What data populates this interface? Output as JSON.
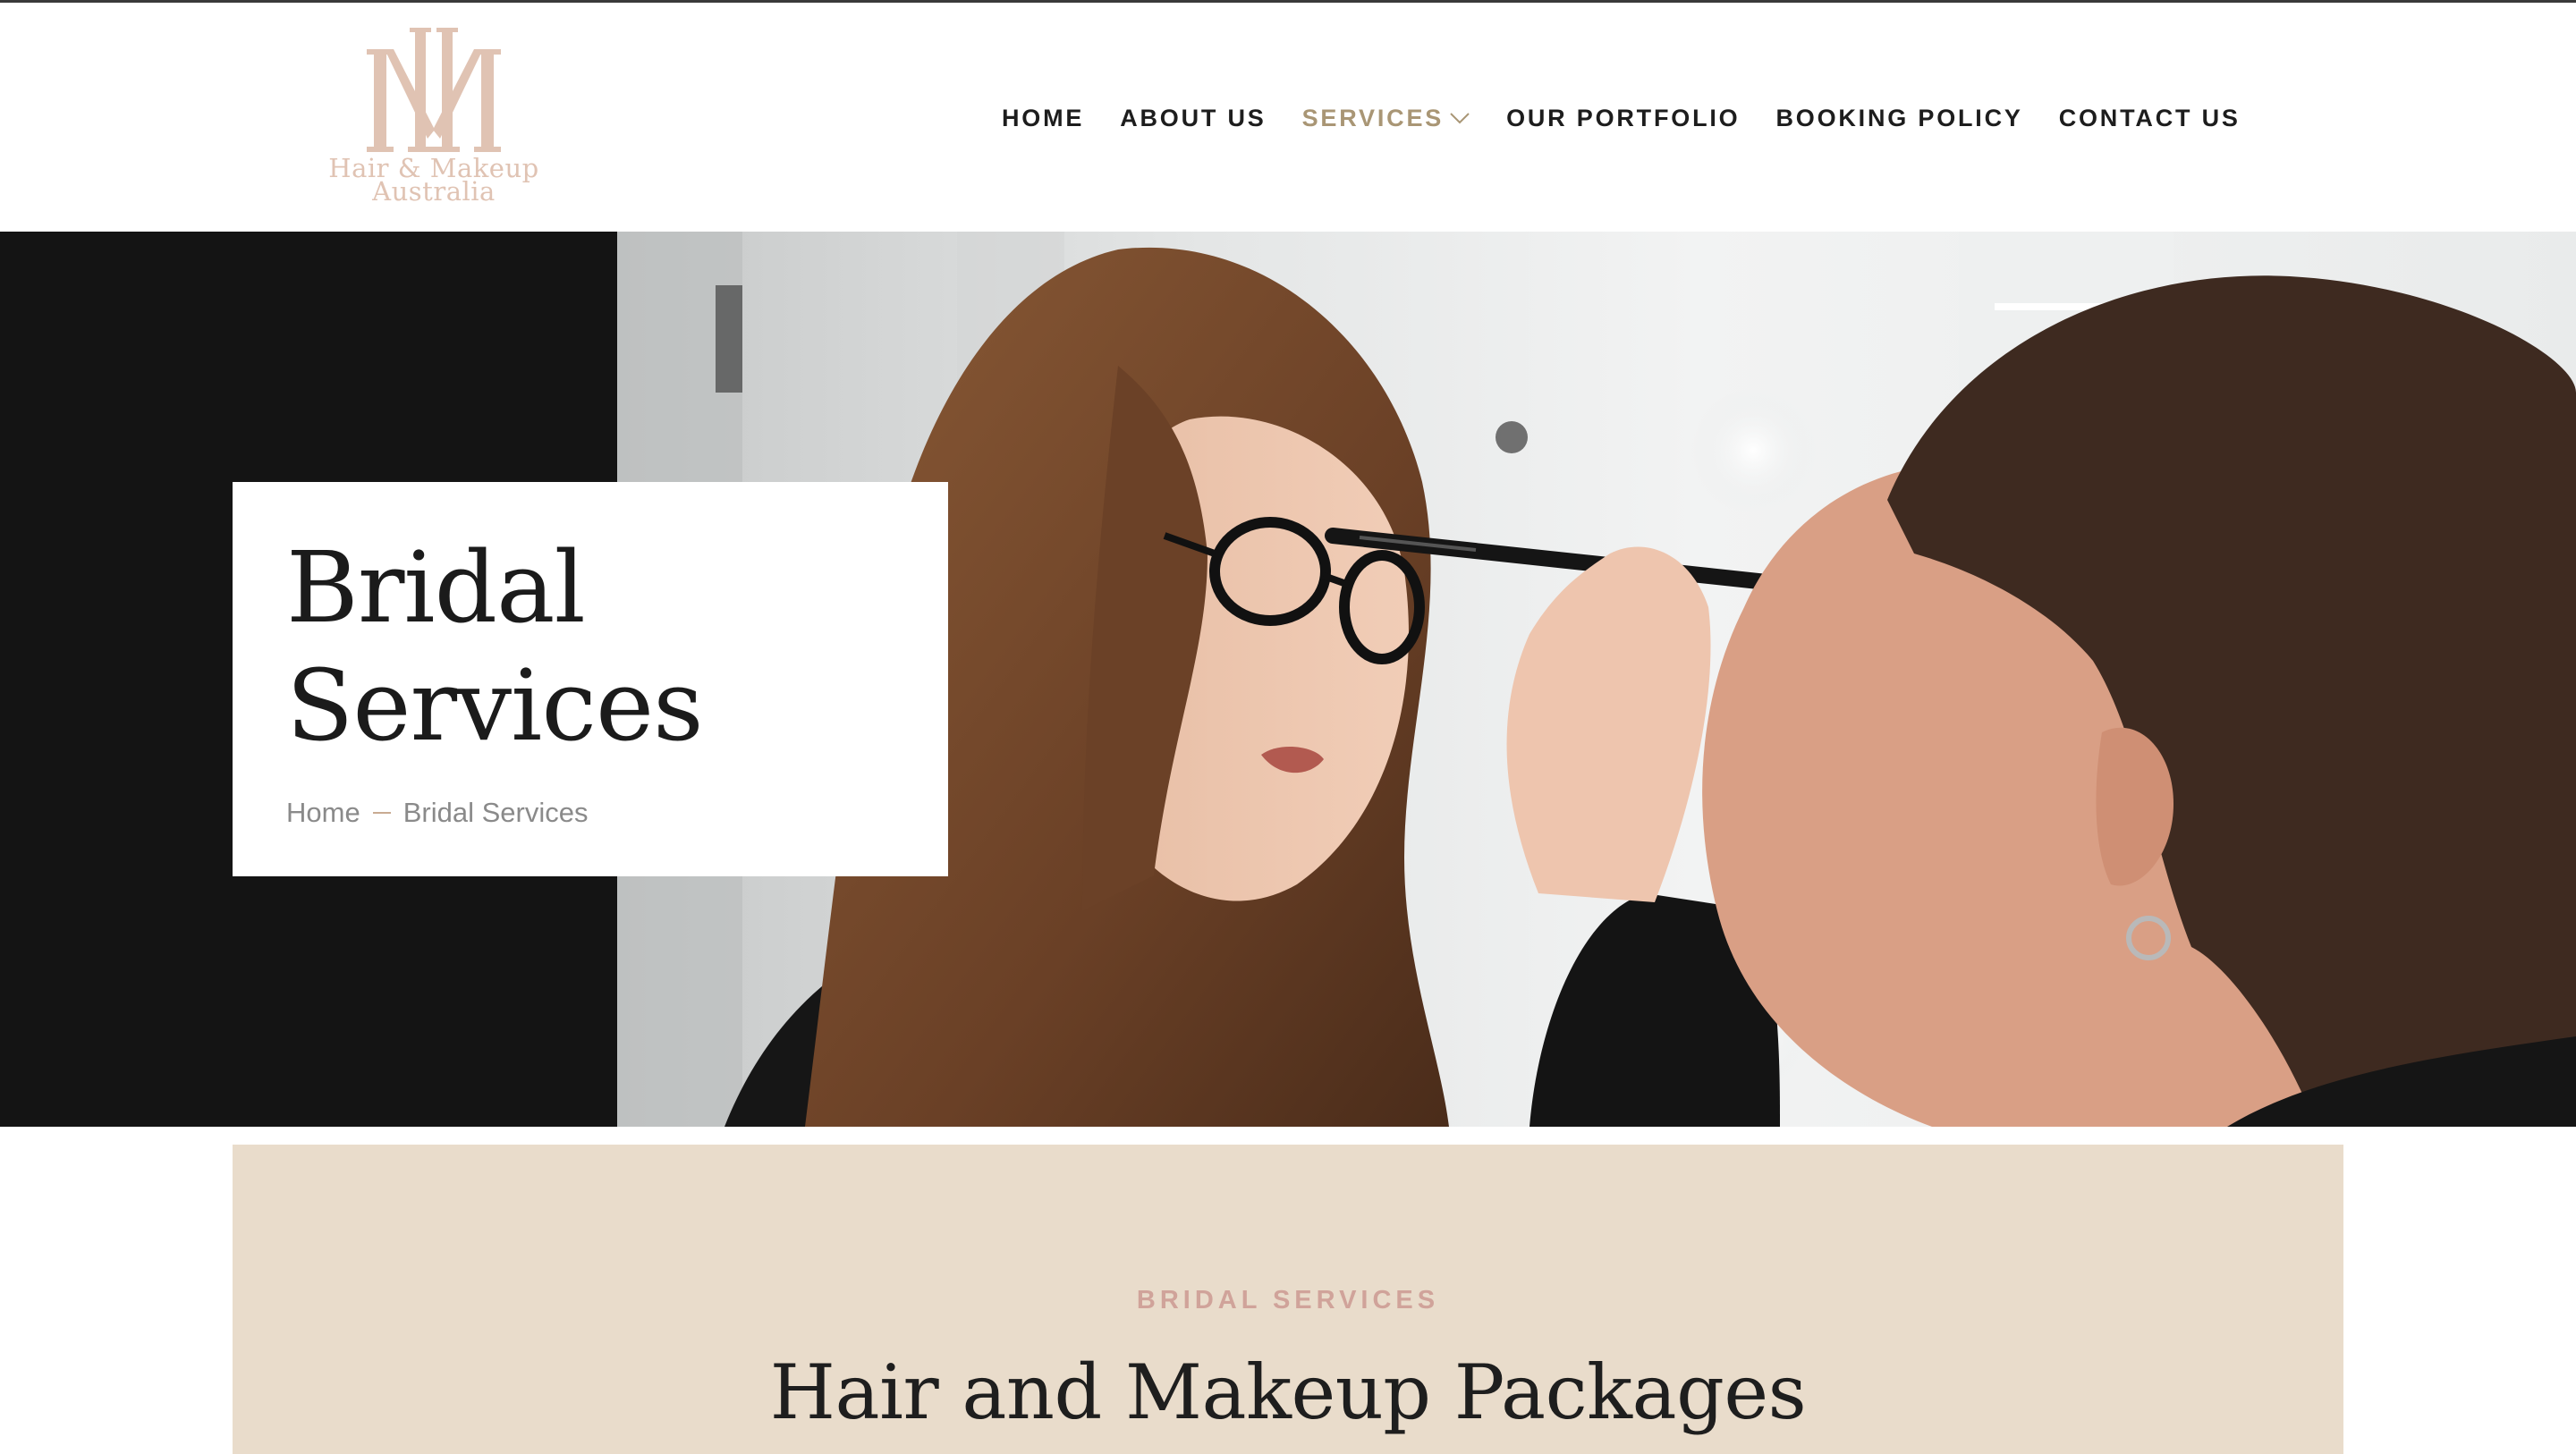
{
  "brand": {
    "monogram": "HM",
    "line1": "Hair & Makeup",
    "line2": "Australia",
    "color": "#e0c3b3"
  },
  "nav": {
    "items": [
      {
        "label": "HOME",
        "active": false
      },
      {
        "label": "ABOUT US",
        "active": false
      },
      {
        "label": "SERVICES",
        "active": true,
        "has_dropdown": true
      },
      {
        "label": "OUR PORTFOLIO",
        "active": false
      },
      {
        "label": "BOOKING POLICY",
        "active": false
      },
      {
        "label": "CONTACT US",
        "active": false
      }
    ],
    "active_color": "#a99675"
  },
  "hero": {
    "title_line1": "Bridal",
    "title_line2": "Services",
    "breadcrumb": {
      "home": "Home",
      "current": "Bridal Services"
    },
    "photo_subject": "makeup artist applying brow pencil to client"
  },
  "packages": {
    "eyebrow": "BRIDAL SERVICES",
    "title": "Hair and Makeup Packages",
    "background": "#e9dccb"
  }
}
